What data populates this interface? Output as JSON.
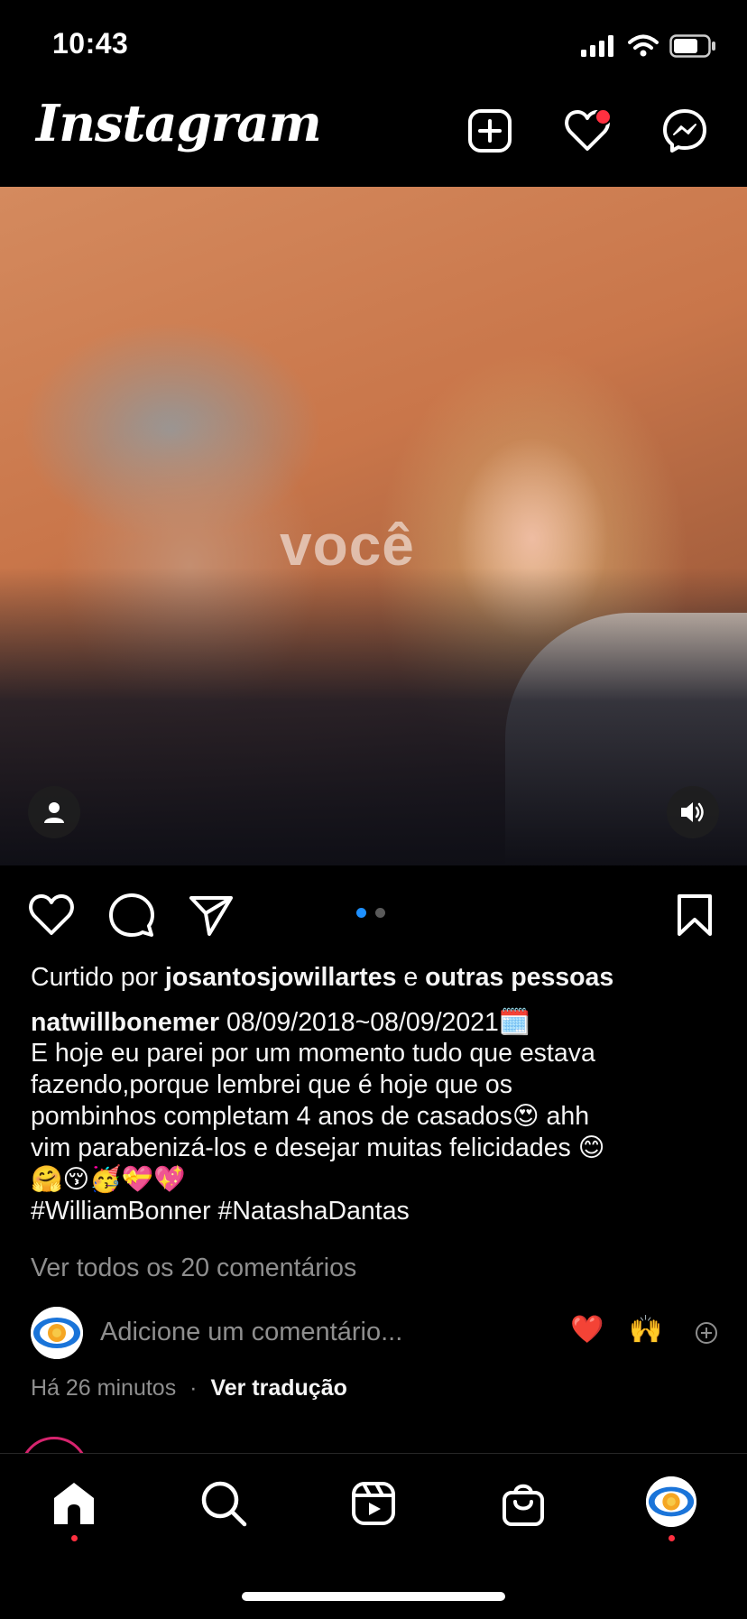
{
  "status_bar": {
    "time": "10:43"
  },
  "header": {
    "logo": "Instagram"
  },
  "media": {
    "watermark": "você"
  },
  "post": {
    "liked_by_prefix": "Curtido por ",
    "liked_by_user": "josantosjowillartes",
    "liked_by_joiner": " e ",
    "liked_by_others": "outras pessoas",
    "username": "natwillbonemer",
    "caption_date": " 08/09/2018~08/09/2021🗓️",
    "caption_lines": [
      "E hoje eu parei por um momento tudo que estava",
      "fazendo,porque lembrei que é hoje que os",
      "pombinhos completam 4 anos de casados😍 ahh",
      "vim  parabenizá-los e desejar muitas felicidades 😊",
      "🤗😚🥳💝💖"
    ],
    "hashtags": "#WilliamBonner #NatashaDantas",
    "view_comments": "Ver todos os 20 comentários",
    "comment_placeholder": "Adicione um comentário...",
    "quick_reactions": [
      "❤️",
      "🙌"
    ],
    "timestamp": "Há 26 minutos",
    "separator": "·",
    "translate": "Ver tradução",
    "carousel": {
      "count": 2,
      "active": 0
    }
  },
  "colors": {
    "notification": "#ff3040",
    "carousel_active": "#1e90ff",
    "muted_text": "#8e8e8e"
  },
  "icons": {
    "header": [
      "plus-square-icon",
      "heart-icon",
      "messenger-icon"
    ],
    "actions": [
      "like-icon",
      "comment-icon",
      "share-icon",
      "bookmark-icon"
    ],
    "media": [
      "tagged-user-icon",
      "volume-icon"
    ],
    "tabs": [
      "home-icon",
      "search-icon",
      "reels-icon",
      "shop-icon",
      "profile-avatar"
    ]
  }
}
